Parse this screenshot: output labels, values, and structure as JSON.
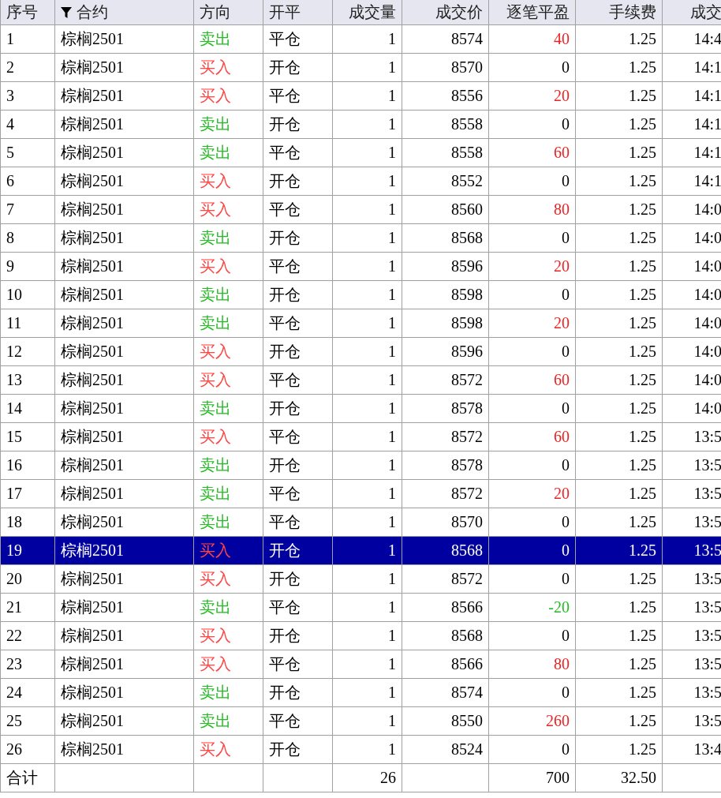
{
  "table": {
    "columns": [
      {
        "label": "序号",
        "filter": false
      },
      {
        "label": "合约",
        "filter": true
      },
      {
        "label": "方向",
        "filter": false
      },
      {
        "label": "开平",
        "filter": false
      },
      {
        "label": "成交量",
        "filter": false
      },
      {
        "label": "成交价",
        "filter": false
      },
      {
        "label": "逐笔平盈",
        "filter": false
      },
      {
        "label": "手续费",
        "filter": false
      },
      {
        "label": "成交",
        "filter": false
      }
    ],
    "rows": [
      {
        "no": "1",
        "contract": "棕榈2501",
        "side": {
          "text": "卖出",
          "color": "#22bb22"
        },
        "offset": "平仓",
        "qty": "1",
        "price": "8574",
        "pnl": {
          "text": "40",
          "color": "#ee2222"
        },
        "fee": "1.25",
        "time": "14:4",
        "selected": false
      },
      {
        "no": "2",
        "contract": "棕榈2501",
        "side": {
          "text": "买入",
          "color": "#ff4444"
        },
        "offset": "开仓",
        "qty": "1",
        "price": "8570",
        "pnl": {
          "text": "0",
          "color": "#000000"
        },
        "fee": "1.25",
        "time": "14:1",
        "selected": false
      },
      {
        "no": "3",
        "contract": "棕榈2501",
        "side": {
          "text": "买入",
          "color": "#ff4444"
        },
        "offset": "平仓",
        "qty": "1",
        "price": "8556",
        "pnl": {
          "text": "20",
          "color": "#ee2222"
        },
        "fee": "1.25",
        "time": "14:1",
        "selected": false
      },
      {
        "no": "4",
        "contract": "棕榈2501",
        "side": {
          "text": "卖出",
          "color": "#22bb22"
        },
        "offset": "开仓",
        "qty": "1",
        "price": "8558",
        "pnl": {
          "text": "0",
          "color": "#000000"
        },
        "fee": "1.25",
        "time": "14:1",
        "selected": false
      },
      {
        "no": "5",
        "contract": "棕榈2501",
        "side": {
          "text": "卖出",
          "color": "#22bb22"
        },
        "offset": "平仓",
        "qty": "1",
        "price": "8558",
        "pnl": {
          "text": "60",
          "color": "#ee2222"
        },
        "fee": "1.25",
        "time": "14:1",
        "selected": false
      },
      {
        "no": "6",
        "contract": "棕榈2501",
        "side": {
          "text": "买入",
          "color": "#ff4444"
        },
        "offset": "开仓",
        "qty": "1",
        "price": "8552",
        "pnl": {
          "text": "0",
          "color": "#000000"
        },
        "fee": "1.25",
        "time": "14:1",
        "selected": false
      },
      {
        "no": "7",
        "contract": "棕榈2501",
        "side": {
          "text": "买入",
          "color": "#ff4444"
        },
        "offset": "平仓",
        "qty": "1",
        "price": "8560",
        "pnl": {
          "text": "80",
          "color": "#ee2222"
        },
        "fee": "1.25",
        "time": "14:0",
        "selected": false
      },
      {
        "no": "8",
        "contract": "棕榈2501",
        "side": {
          "text": "卖出",
          "color": "#22bb22"
        },
        "offset": "开仓",
        "qty": "1",
        "price": "8568",
        "pnl": {
          "text": "0",
          "color": "#000000"
        },
        "fee": "1.25",
        "time": "14:0",
        "selected": false
      },
      {
        "no": "9",
        "contract": "棕榈2501",
        "side": {
          "text": "买入",
          "color": "#ff4444"
        },
        "offset": "平仓",
        "qty": "1",
        "price": "8596",
        "pnl": {
          "text": "20",
          "color": "#ee2222"
        },
        "fee": "1.25",
        "time": "14:0",
        "selected": false
      },
      {
        "no": "10",
        "contract": "棕榈2501",
        "side": {
          "text": "卖出",
          "color": "#22bb22"
        },
        "offset": "开仓",
        "qty": "1",
        "price": "8598",
        "pnl": {
          "text": "0",
          "color": "#000000"
        },
        "fee": "1.25",
        "time": "14:0",
        "selected": false
      },
      {
        "no": "11",
        "contract": "棕榈2501",
        "side": {
          "text": "卖出",
          "color": "#22bb22"
        },
        "offset": "平仓",
        "qty": "1",
        "price": "8598",
        "pnl": {
          "text": "20",
          "color": "#ee2222"
        },
        "fee": "1.25",
        "time": "14:0",
        "selected": false
      },
      {
        "no": "12",
        "contract": "棕榈2501",
        "side": {
          "text": "买入",
          "color": "#ff4444"
        },
        "offset": "开仓",
        "qty": "1",
        "price": "8596",
        "pnl": {
          "text": "0",
          "color": "#000000"
        },
        "fee": "1.25",
        "time": "14:0",
        "selected": false
      },
      {
        "no": "13",
        "contract": "棕榈2501",
        "side": {
          "text": "买入",
          "color": "#ff4444"
        },
        "offset": "平仓",
        "qty": "1",
        "price": "8572",
        "pnl": {
          "text": "60",
          "color": "#ee2222"
        },
        "fee": "1.25",
        "time": "14:0",
        "selected": false
      },
      {
        "no": "14",
        "contract": "棕榈2501",
        "side": {
          "text": "卖出",
          "color": "#22bb22"
        },
        "offset": "开仓",
        "qty": "1",
        "price": "8578",
        "pnl": {
          "text": "0",
          "color": "#000000"
        },
        "fee": "1.25",
        "time": "14:0",
        "selected": false
      },
      {
        "no": "15",
        "contract": "棕榈2501",
        "side": {
          "text": "买入",
          "color": "#ff4444"
        },
        "offset": "平仓",
        "qty": "1",
        "price": "8572",
        "pnl": {
          "text": "60",
          "color": "#ee2222"
        },
        "fee": "1.25",
        "time": "13:5",
        "selected": false
      },
      {
        "no": "16",
        "contract": "棕榈2501",
        "side": {
          "text": "卖出",
          "color": "#22bb22"
        },
        "offset": "开仓",
        "qty": "1",
        "price": "8578",
        "pnl": {
          "text": "0",
          "color": "#000000"
        },
        "fee": "1.25",
        "time": "13:5",
        "selected": false
      },
      {
        "no": "17",
        "contract": "棕榈2501",
        "side": {
          "text": "卖出",
          "color": "#22bb22"
        },
        "offset": "平仓",
        "qty": "1",
        "price": "8572",
        "pnl": {
          "text": "20",
          "color": "#ee2222"
        },
        "fee": "1.25",
        "time": "13:5",
        "selected": false
      },
      {
        "no": "18",
        "contract": "棕榈2501",
        "side": {
          "text": "卖出",
          "color": "#22bb22"
        },
        "offset": "平仓",
        "qty": "1",
        "price": "8570",
        "pnl": {
          "text": "0",
          "color": "#000000"
        },
        "fee": "1.25",
        "time": "13:5",
        "selected": false
      },
      {
        "no": "19",
        "contract": "棕榈2501",
        "side": {
          "text": "买入",
          "color": "#ff4444"
        },
        "offset": "开仓",
        "qty": "1",
        "price": "8568",
        "pnl": {
          "text": "0",
          "color": "#ffffff"
        },
        "fee": "1.25",
        "time": "13:5",
        "selected": true
      },
      {
        "no": "20",
        "contract": "棕榈2501",
        "side": {
          "text": "买入",
          "color": "#ff4444"
        },
        "offset": "开仓",
        "qty": "1",
        "price": "8572",
        "pnl": {
          "text": "0",
          "color": "#000000"
        },
        "fee": "1.25",
        "time": "13:5",
        "selected": false
      },
      {
        "no": "21",
        "contract": "棕榈2501",
        "side": {
          "text": "卖出",
          "color": "#22bb22"
        },
        "offset": "平仓",
        "qty": "1",
        "price": "8566",
        "pnl": {
          "text": "-20",
          "color": "#22bb22"
        },
        "fee": "1.25",
        "time": "13:5",
        "selected": false
      },
      {
        "no": "22",
        "contract": "棕榈2501",
        "side": {
          "text": "买入",
          "color": "#ff4444"
        },
        "offset": "开仓",
        "qty": "1",
        "price": "8568",
        "pnl": {
          "text": "0",
          "color": "#000000"
        },
        "fee": "1.25",
        "time": "13:5",
        "selected": false
      },
      {
        "no": "23",
        "contract": "棕榈2501",
        "side": {
          "text": "买入",
          "color": "#ff4444"
        },
        "offset": "平仓",
        "qty": "1",
        "price": "8566",
        "pnl": {
          "text": "80",
          "color": "#ee2222"
        },
        "fee": "1.25",
        "time": "13:5",
        "selected": false
      },
      {
        "no": "24",
        "contract": "棕榈2501",
        "side": {
          "text": "卖出",
          "color": "#22bb22"
        },
        "offset": "开仓",
        "qty": "1",
        "price": "8574",
        "pnl": {
          "text": "0",
          "color": "#000000"
        },
        "fee": "1.25",
        "time": "13:5",
        "selected": false
      },
      {
        "no": "25",
        "contract": "棕榈2501",
        "side": {
          "text": "卖出",
          "color": "#22bb22"
        },
        "offset": "平仓",
        "qty": "1",
        "price": "8550",
        "pnl": {
          "text": "260",
          "color": "#ee2222"
        },
        "fee": "1.25",
        "time": "13:5",
        "selected": false
      },
      {
        "no": "26",
        "contract": "棕榈2501",
        "side": {
          "text": "买入",
          "color": "#ff4444"
        },
        "offset": "开仓",
        "qty": "1",
        "price": "8524",
        "pnl": {
          "text": "0",
          "color": "#000000"
        },
        "fee": "1.25",
        "time": "13:4",
        "selected": false
      }
    ],
    "total": {
      "label": "合计",
      "qty": "26",
      "pnl": "700",
      "fee": "32.50"
    }
  }
}
